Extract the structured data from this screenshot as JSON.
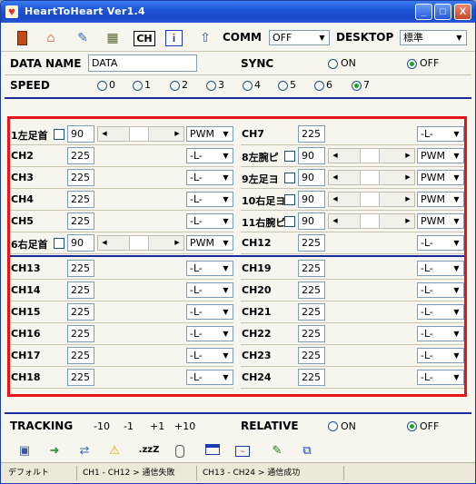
{
  "window": {
    "title": "HeartToHeart Ver1.4",
    "minimize": "_",
    "maximize": "□",
    "close": "X"
  },
  "toolbar": {
    "icons": [
      "battery-icon",
      "home-icon",
      "wrench-icon",
      "scanner-icon",
      "ch-icon",
      "info-icon",
      "upload-icon"
    ],
    "ch_text": "CH",
    "info_text": "i",
    "comm_label": "COMM",
    "comm_value": "OFF",
    "desktop_label": "DESKTOP",
    "desktop_value": "標準"
  },
  "header": {
    "data_name_label": "DATA NAME",
    "data_name_value": "DATA",
    "sync_label": "SYNC",
    "sync_on": "ON",
    "sync_off": "OFF",
    "speed_label": "SPEED",
    "speed_options": [
      "0",
      "1",
      "2",
      "3",
      "4",
      "5",
      "6",
      "7"
    ],
    "speed_selected": "7"
  },
  "channels_left_top": [
    {
      "label": "1左足首",
      "value": "90",
      "type": "slider",
      "mode": "PWM"
    },
    {
      "label": "CH2",
      "value": "225",
      "type": "plain",
      "mode": "-L-"
    },
    {
      "label": "CH3",
      "value": "225",
      "type": "plain",
      "mode": "-L-"
    },
    {
      "label": "CH4",
      "value": "225",
      "type": "plain",
      "mode": "-L-"
    },
    {
      "label": "CH5",
      "value": "225",
      "type": "plain",
      "mode": "-L-"
    },
    {
      "label": "6右足首",
      "value": "90",
      "type": "slider",
      "mode": "PWM"
    }
  ],
  "channels_right_top": [
    {
      "label": "CH7",
      "value": "225",
      "type": "plain",
      "mode": "-L-"
    },
    {
      "label": "8左腕ピ",
      "value": "90",
      "type": "slider",
      "mode": "PWM"
    },
    {
      "label": "9左足ヨ",
      "value": "90",
      "type": "slider",
      "mode": "PWM"
    },
    {
      "label": "10右足ヨ",
      "value": "90",
      "type": "slider",
      "mode": "PWM"
    },
    {
      "label": "11右腕ピ",
      "value": "90",
      "type": "slider",
      "mode": "PWM"
    },
    {
      "label": "CH12",
      "value": "225",
      "type": "plain",
      "mode": "-L-"
    }
  ],
  "channels_left_bottom": [
    {
      "label": "CH13",
      "value": "225",
      "mode": "-L-"
    },
    {
      "label": "CH14",
      "value": "225",
      "mode": "-L-"
    },
    {
      "label": "CH15",
      "value": "225",
      "mode": "-L-"
    },
    {
      "label": "CH16",
      "value": "225",
      "mode": "-L-"
    },
    {
      "label": "CH17",
      "value": "225",
      "mode": "-L-"
    },
    {
      "label": "CH18",
      "value": "225",
      "mode": "-L-"
    }
  ],
  "channels_right_bottom": [
    {
      "label": "CH19",
      "value": "225",
      "mode": "-L-"
    },
    {
      "label": "CH20",
      "value": "225",
      "mode": "-L-"
    },
    {
      "label": "CH21",
      "value": "225",
      "mode": "-L-"
    },
    {
      "label": "CH22",
      "value": "225",
      "mode": "-L-"
    },
    {
      "label": "CH23",
      "value": "225",
      "mode": "-L-"
    },
    {
      "label": "CH24",
      "value": "225",
      "mode": "-L-"
    }
  ],
  "tracking": {
    "label": "TRACKING",
    "buttons": [
      "-10",
      "-1",
      "+1",
      "+10"
    ],
    "relative_label": "RELATIVE",
    "relative_on": "ON",
    "relative_off": "OFF"
  },
  "bottom_toolbar": {
    "icons": [
      "camera-icon",
      "transfer-icon",
      "network-icon",
      "warning-icon",
      "sleep-icon",
      "mouse-icon",
      "window-icon",
      "graph-icon",
      "edit-icon",
      "copy-icon"
    ],
    "sleep_text": ".zzZ"
  },
  "status": {
    "cell1": "デフォルト",
    "cell2": "CH1 - CH12 > 通信失敗",
    "cell3": "CH13 - CH24 > 通信成功"
  },
  "colors": {
    "title_blue": "#1d55d8",
    "highlight_red": "#e8141c",
    "separator_blue": "#1a2aa0",
    "radio_green": "#21a121"
  }
}
